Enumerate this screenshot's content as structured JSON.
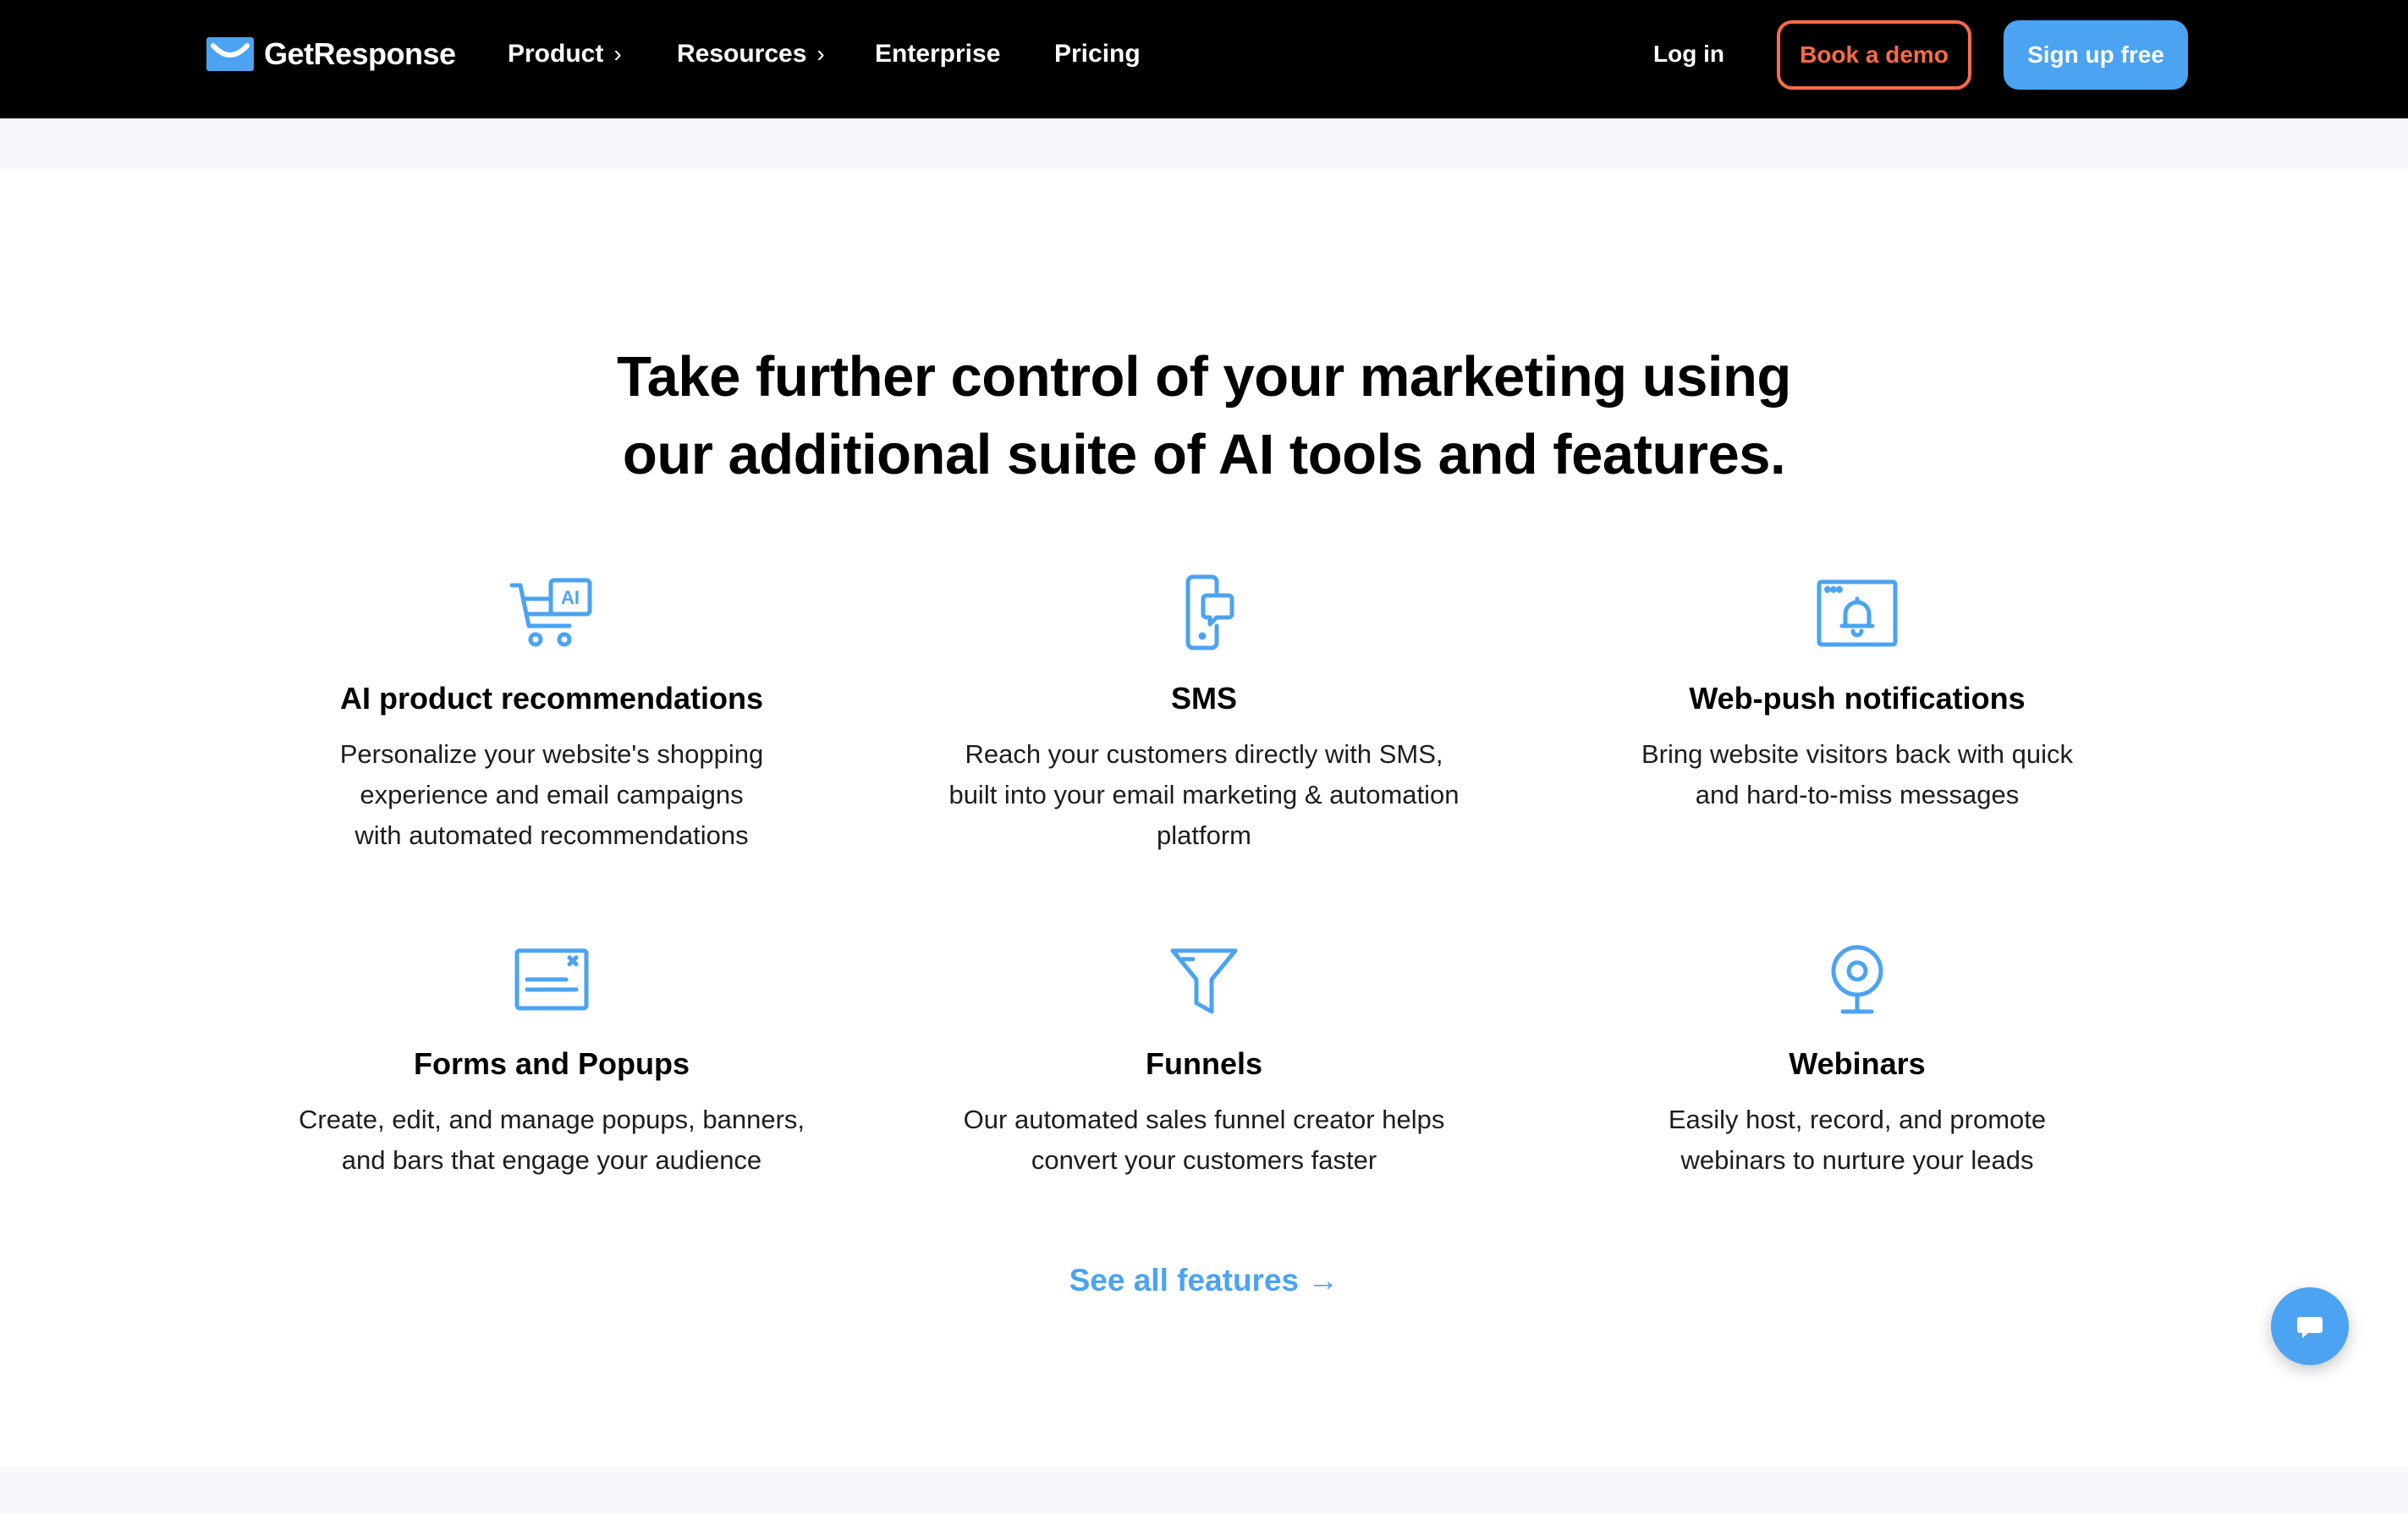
{
  "nav": {
    "logo_text": "GetResponse",
    "items": [
      {
        "label": "Product",
        "chevron": "›"
      },
      {
        "label": "Resources",
        "chevron": "›"
      },
      {
        "label": "Enterprise"
      },
      {
        "label": "Pricing"
      }
    ],
    "login_label": "Log in",
    "demo_label": "Book a demo",
    "signup_label": "Sign up free"
  },
  "headline": {
    "line1": "Take further control of your marketing using",
    "line2": "our additional suite of AI tools and features."
  },
  "features": [
    {
      "icon": "cart-ai-icon",
      "title": "AI product recommendations",
      "desc_lines": [
        "Personalize your website's shopping",
        "experience and email campaigns",
        "with automated recommendations"
      ]
    },
    {
      "icon": "phone-message-icon",
      "title": "SMS",
      "desc_lines": [
        "Reach your customers directly with SMS,",
        "built into your email marketing & automation",
        "platform"
      ]
    },
    {
      "icon": "browser-bell-icon",
      "title": "Web-push notifications",
      "desc_lines": [
        "Bring website visitors back with quick",
        "and hard-to-miss messages"
      ]
    },
    {
      "icon": "form-popup-icon",
      "title": "Forms and Popups",
      "desc_lines": [
        "Create, edit, and manage popups, banners,",
        "and bars that engage your audience"
      ]
    },
    {
      "icon": "funnel-icon",
      "title": "Funnels",
      "desc_lines": [
        "Our automated sales funnel creator helps",
        "convert your customers faster"
      ]
    },
    {
      "icon": "webcam-icon",
      "title": "Webinars",
      "desc_lines": [
        "Easily host, record, and promote",
        "webinars to nurture your leads"
      ]
    }
  ],
  "see_all": {
    "label": "See all features",
    "arrow": "→"
  },
  "colors": {
    "nav_bg": "#000000",
    "accent_blue": "#4ba3f2",
    "demo_orange": "#ff6a4a",
    "band_bg": "#f7f7fc"
  },
  "chat": {
    "icon": "chat-bubble-icon"
  }
}
